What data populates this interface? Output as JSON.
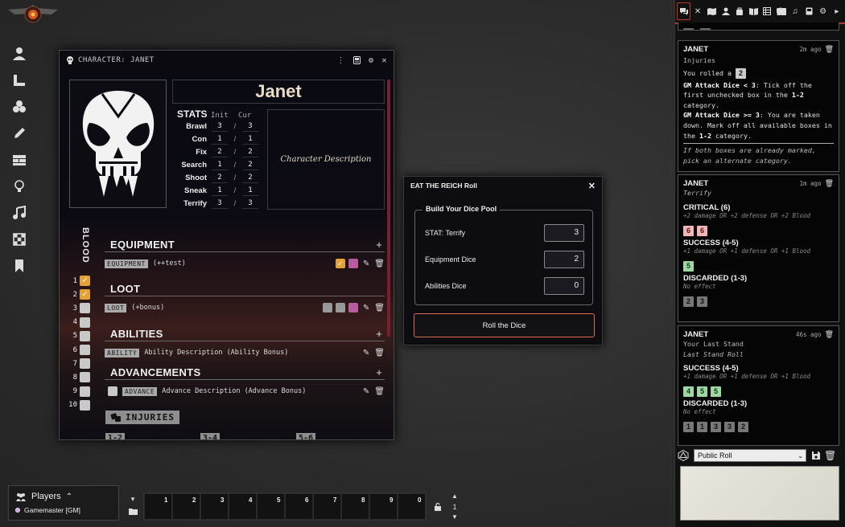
{
  "character_sheet": {
    "title": "CHARACTER: JANET",
    "name": "Janet",
    "stats_label": "STATS",
    "init_header": "Init",
    "cur_header": "Cur",
    "stats": [
      {
        "name": "Brawl",
        "init": "3",
        "cur": "3"
      },
      {
        "name": "Con",
        "init": "1",
        "cur": "1"
      },
      {
        "name": "Fix",
        "init": "2",
        "cur": "2"
      },
      {
        "name": "Search",
        "init": "1",
        "cur": "2"
      },
      {
        "name": "Shoot",
        "init": "2",
        "cur": "2"
      },
      {
        "name": "Sneak",
        "init": "1",
        "cur": "1"
      },
      {
        "name": "Terrify",
        "init": "3",
        "cur": "3"
      }
    ],
    "description": "Character Description",
    "blood_label": "BLOOD",
    "blood_boxes": [
      {
        "n": "1",
        "checked": true
      },
      {
        "n": "2",
        "checked": true
      },
      {
        "n": "3",
        "checked": false
      },
      {
        "n": "4",
        "checked": false
      },
      {
        "n": "5",
        "checked": false
      },
      {
        "n": "6",
        "checked": false
      },
      {
        "n": "7",
        "checked": false
      },
      {
        "n": "8",
        "checked": false
      },
      {
        "n": "9",
        "checked": false
      },
      {
        "n": "10",
        "checked": false
      }
    ],
    "equipment": {
      "title": "EQUIPMENT",
      "tag": "EQUIPMENT",
      "text": "(++test)"
    },
    "loot": {
      "title": "LOOT",
      "tag": "LOOT",
      "text": "(+bonus)"
    },
    "abilities": {
      "title": "ABILITIES",
      "tag": "ABILITY",
      "text": "Ability Description (Ability Bonus)"
    },
    "advancements": {
      "title": "ADVANCEMENTS",
      "tag": "ADVANCE",
      "text": "Advance Description (Advance Bonus)"
    },
    "injuries": {
      "title": "INJURIES",
      "columns": [
        "1-2",
        "3-4",
        "5-6"
      ]
    }
  },
  "roll_dialog": {
    "title": "EAT THE REICH Roll",
    "legend": "Build Your Dice Pool",
    "fields": [
      {
        "label": "STAT: Terrify",
        "value": "3"
      },
      {
        "label": "Equipment Dice",
        "value": "2"
      },
      {
        "label": "Abilities Dice",
        "value": "0"
      }
    ],
    "button": "Roll the Dice"
  },
  "chat": {
    "messages": [
      {
        "speaker": "JANET",
        "time": "2m ago",
        "flavor": "Injuries",
        "rolled_prefix": "You rolled a",
        "rolled_value": "2",
        "line1_bold": "GM Attack Dice < 3",
        "line1_a": ": Tick off the first unchecked box in the ",
        "line1_cat": "1-2",
        "line1_b": " category.",
        "line2_bold": "GM Attack Dice >= 3",
        "line2_a": ": You are taken down. Mark off all available boxes in the ",
        "line2_cat": "1-2",
        "line2_b": " category.",
        "note": "If both boxes are already marked, pick an alternate category."
      },
      {
        "speaker": "JANET",
        "time": "1m ago",
        "flavor": "Terrify",
        "groups": [
          {
            "title": "CRITICAL (6)",
            "desc": "+2 damage OR +2 defense OR +2 Blood",
            "dice": [
              "6",
              "6"
            ],
            "style": "r"
          },
          {
            "title": "SUCCESS (4-5)",
            "desc": "+1 damage OR +1 defense OR +1 Blood",
            "dice": [
              "5"
            ],
            "style": "gr"
          },
          {
            "title": "DISCARDED (1-3)",
            "desc": "No effect",
            "dice": [
              "2",
              "3"
            ],
            "style": "gy"
          }
        ]
      },
      {
        "speaker": "JANET",
        "time": "46s ago",
        "flavor": "Your Last Stand",
        "subtitle": "Last Stand Roll",
        "groups": [
          {
            "title": "SUCCESS (4-5)",
            "desc": "+1 damage OR +1 defense OR +1 Blood",
            "dice": [
              "4",
              "5",
              "5"
            ],
            "style": "gr"
          },
          {
            "title": "DISCARDED (1-3)",
            "desc": "No effect",
            "dice": [
              "1",
              "1",
              "3",
              "3",
              "2"
            ],
            "style": "gy"
          }
        ]
      }
    ],
    "roll_mode": "Public Roll"
  },
  "players": {
    "title": "Players",
    "list": [
      {
        "name": "Gamemaster [GM]"
      }
    ]
  },
  "hotbar": {
    "slots": [
      "1",
      "2",
      "3",
      "4",
      "5",
      "6",
      "7",
      "8",
      "9",
      "0"
    ],
    "page": "1"
  },
  "icons": {
    "sidebar_tabs": [
      "chat-icon",
      "combat-icon",
      "scenes-icon",
      "actors-icon",
      "items-icon",
      "journal-icon",
      "tables-icon",
      "cards-icon",
      "playlists-icon",
      "compendium-icon",
      "settings-icon",
      "collapse-icon"
    ],
    "left_tools": [
      "token-icon",
      "measure-icon",
      "tiles-icon",
      "draw-icon",
      "walls-icon",
      "lighting-icon",
      "sounds-icon",
      "regions-icon",
      "notes-icon"
    ]
  },
  "colors": {
    "accent_red": "#c4342b",
    "blood_checked": "#e3a233",
    "critical_die": "#f2b6b6",
    "success_die": "#9fd7a4",
    "roll_button_border": "#e06a50"
  }
}
